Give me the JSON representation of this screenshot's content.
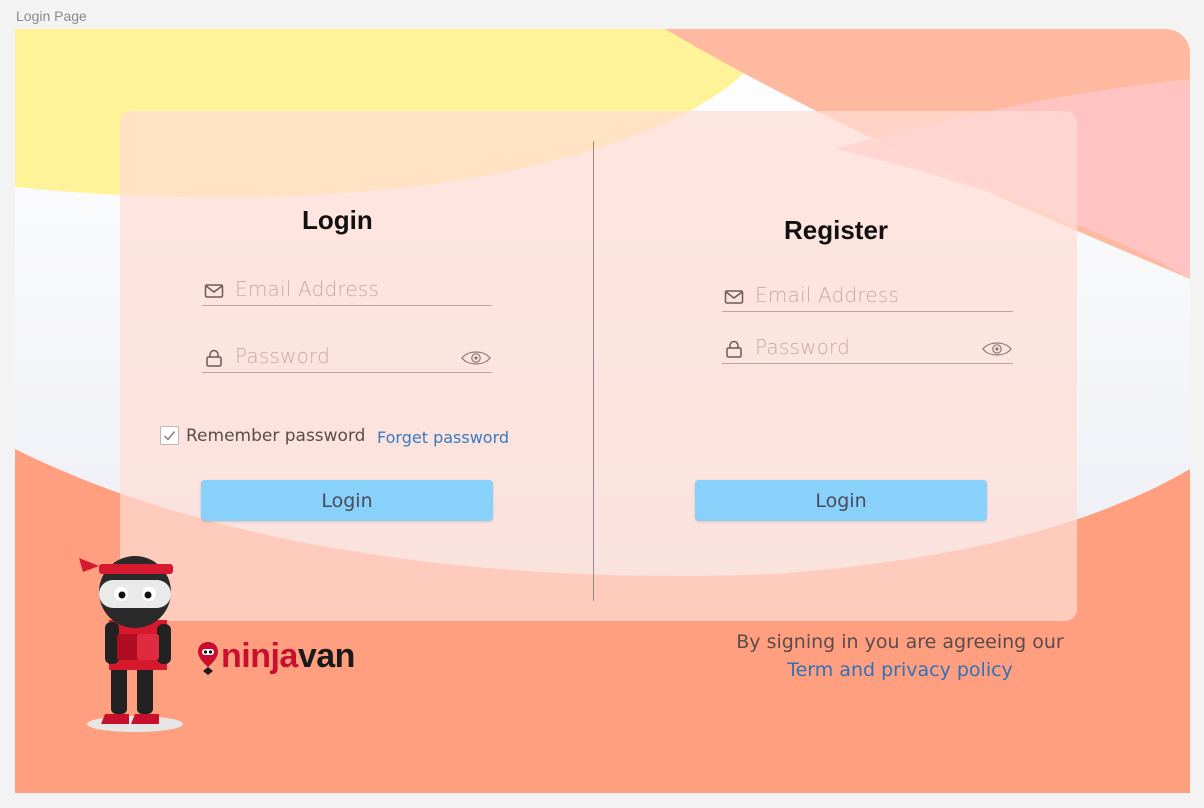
{
  "frame_label": "Login Page",
  "login": {
    "title": "Login",
    "email_placeholder": "Email Address",
    "password_placeholder": "Password",
    "remember_label": "Remember password",
    "remember_checked": true,
    "forget_label": "Forget password",
    "button_label": "Login"
  },
  "register": {
    "title": "Register",
    "email_placeholder": "Email Address",
    "password_placeholder": "Password",
    "button_label": "Login"
  },
  "brand": {
    "logo_part1": "ninja",
    "logo_part2": "van",
    "logo_colors": {
      "ninja": "#c8102e",
      "van": "#1a1a1a"
    }
  },
  "footer": {
    "agree_text": "By signing in you are agreeing our",
    "policy_link": "Term and privacy policy"
  },
  "icons": {
    "email": "mail-icon",
    "password": "lock-icon",
    "show_password": "eye-icon",
    "checkbox": "check-icon"
  },
  "colors": {
    "button": "#87d1fb",
    "link": "#3a7bc0",
    "background_top": "#fff39a",
    "background_accent": "#ffb9a0",
    "background_bottom": "#ff9f80"
  }
}
